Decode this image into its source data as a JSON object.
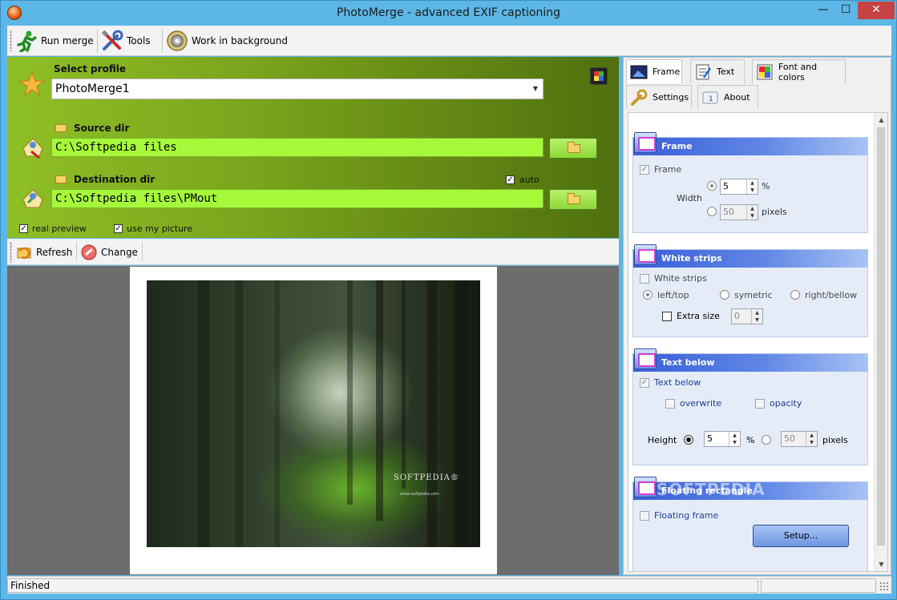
{
  "window": {
    "title": "PhotoMerge - advanced EXIF captioning",
    "minimize_glyph": "—",
    "maximize_glyph": "☐",
    "close_glyph": "✕"
  },
  "toolbar": {
    "run_merge": "Run merge",
    "tools": "Tools",
    "work_in_background": "Work in background"
  },
  "profile": {
    "label": "Select profile",
    "value": "PhotoMerge1"
  },
  "source": {
    "label": "Source dir",
    "value": "C:\\Softpedia files"
  },
  "destination": {
    "label": "Destination dir",
    "value": "C:\\Softpedia files\\PMout",
    "auto_label": "auto",
    "auto_checked": true
  },
  "options": {
    "real_preview": "real preview",
    "use_my_picture": "use my picture"
  },
  "toolbar2": {
    "refresh": "Refresh",
    "change": "Change"
  },
  "preview": {
    "brand": "SOFTPEDIA®",
    "brand_url": "www.softpedia.com"
  },
  "tabs": [
    {
      "label": "Frame",
      "icon": "frame-icon"
    },
    {
      "label": "Text",
      "icon": "text-icon"
    },
    {
      "label": "Font and colors",
      "icon": "palette-icon"
    },
    {
      "label": "Settings",
      "icon": "wrench-icon"
    },
    {
      "label": "About",
      "icon": "info-icon"
    }
  ],
  "frame_group": {
    "title": "Frame",
    "frame_check": "Frame",
    "width_label": "Width",
    "percent_value": "5",
    "percent_unit": "%",
    "pixels_value": "50",
    "pixels_unit": "pixels"
  },
  "strips_group": {
    "title": "White strips",
    "strips_check": "White strips",
    "left_top": "left/top",
    "symetric": "symetric",
    "right_bellow": "right/bellow",
    "extra_size": "Extra size",
    "extra_value": "0"
  },
  "textbelow_group": {
    "title": "Text below",
    "text_below_check": "Text below",
    "overwrite": "overwrite",
    "opacity": "opacity",
    "height_label": "Height",
    "percent_value": "5",
    "percent_unit": "%",
    "pixels_value": "50",
    "pixels_unit": "pixels"
  },
  "floating_group": {
    "title": "Floating rectangle",
    "floating_check": "Floating frame",
    "setup": "Setup..."
  },
  "status": {
    "text": "Finished"
  },
  "watermark": "SOFTPEDIA"
}
